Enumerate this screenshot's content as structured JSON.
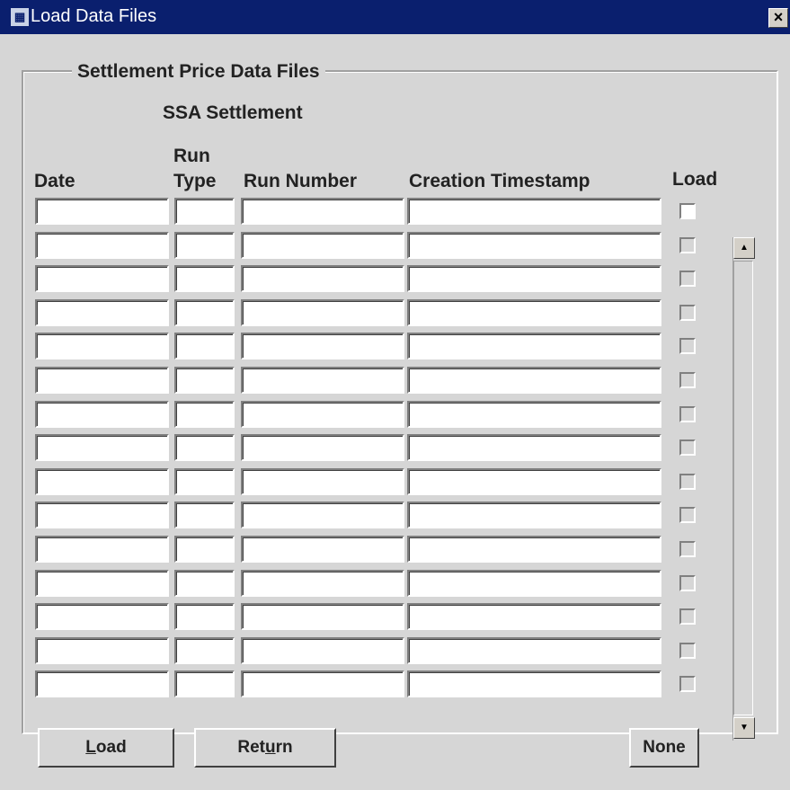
{
  "window": {
    "title": "Load Data Files",
    "close_glyph": "×"
  },
  "group": {
    "label": "Settlement Price Data Files",
    "block_title": "SSA Settlement"
  },
  "columns": {
    "date": "Date",
    "run_type_line1": "Run",
    "run_type_line2": "Type",
    "run_number": "Run Number",
    "creation_timestamp": "Creation Timestamp",
    "load": "Load"
  },
  "rows": [
    {
      "date": "",
      "run_type": "",
      "run_number": "",
      "creation_timestamp": "",
      "load": false
    },
    {
      "date": "",
      "run_type": "",
      "run_number": "",
      "creation_timestamp": "",
      "load": false
    },
    {
      "date": "",
      "run_type": "",
      "run_number": "",
      "creation_timestamp": "",
      "load": false
    },
    {
      "date": "",
      "run_type": "",
      "run_number": "",
      "creation_timestamp": "",
      "load": false
    },
    {
      "date": "",
      "run_type": "",
      "run_number": "",
      "creation_timestamp": "",
      "load": false
    },
    {
      "date": "",
      "run_type": "",
      "run_number": "",
      "creation_timestamp": "",
      "load": false
    },
    {
      "date": "",
      "run_type": "",
      "run_number": "",
      "creation_timestamp": "",
      "load": false
    },
    {
      "date": "",
      "run_type": "",
      "run_number": "",
      "creation_timestamp": "",
      "load": false
    },
    {
      "date": "",
      "run_type": "",
      "run_number": "",
      "creation_timestamp": "",
      "load": false
    },
    {
      "date": "",
      "run_type": "",
      "run_number": "",
      "creation_timestamp": "",
      "load": false
    },
    {
      "date": "",
      "run_type": "",
      "run_number": "",
      "creation_timestamp": "",
      "load": false
    },
    {
      "date": "",
      "run_type": "",
      "run_number": "",
      "creation_timestamp": "",
      "load": false
    },
    {
      "date": "",
      "run_type": "",
      "run_number": "",
      "creation_timestamp": "",
      "load": false
    },
    {
      "date": "",
      "run_type": "",
      "run_number": "",
      "creation_timestamp": "",
      "load": false
    },
    {
      "date": "",
      "run_type": "",
      "run_number": "",
      "creation_timestamp": "",
      "load": false
    }
  ],
  "scrollbar": {
    "up_glyph": "▲",
    "down_glyph": "▼"
  },
  "buttons": {
    "load_label_mnemonic": "L",
    "load_label_rest": "oad",
    "return_label_start": "Ret",
    "return_label_mnemonic": "u",
    "return_label_rest": "rn",
    "none_label": "None"
  },
  "colors": {
    "titlebar": "#0a1f6e",
    "face": "#d6d6d6",
    "field": "#ffffff"
  }
}
